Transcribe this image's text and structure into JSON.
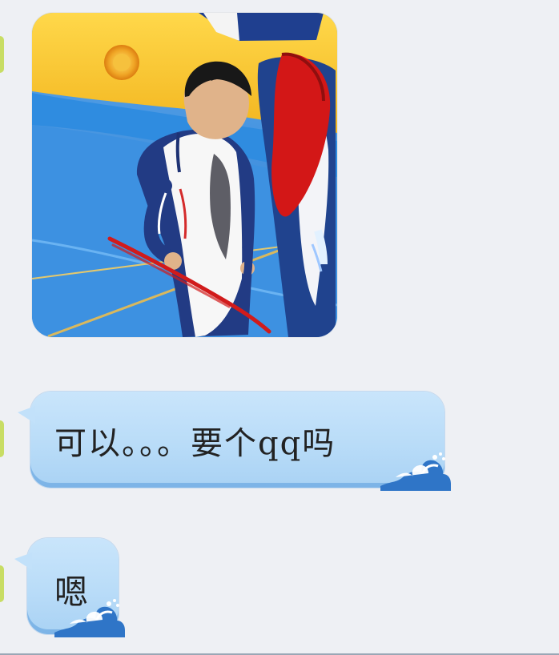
{
  "messages": [
    {
      "type": "image",
      "alt": ""
    },
    {
      "type": "text",
      "text": "可以。。。要个qq吗"
    },
    {
      "type": "text",
      "text": "嗯"
    }
  ],
  "colors": {
    "background": "#eef0f4",
    "bubble": "#bfdff9",
    "bubble_border": "#4a96d8",
    "avatar_stub": "#c8dd64"
  }
}
